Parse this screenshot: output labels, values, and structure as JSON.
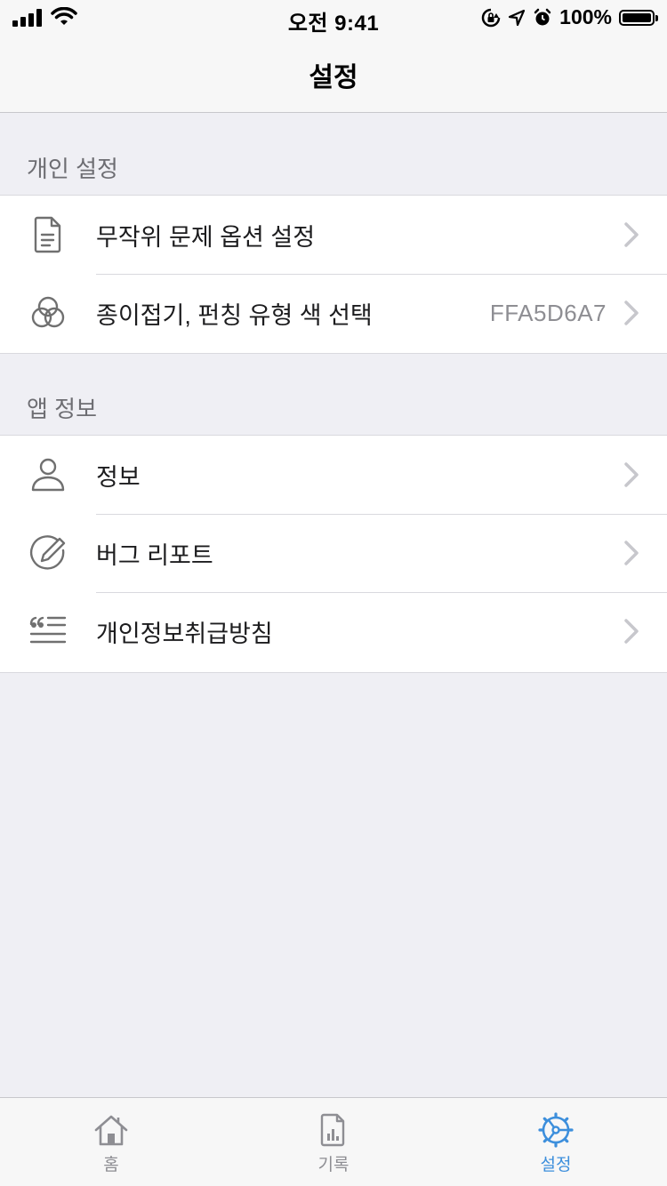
{
  "status_bar": {
    "time": "오전 9:41",
    "battery": "100%"
  },
  "nav": {
    "title": "설정"
  },
  "sections": [
    {
      "header": "개인 설정",
      "rows": [
        {
          "label": "무작위 문제 옵션 설정",
          "icon": "document-icon",
          "detail": ""
        },
        {
          "label": "종이접기, 펀칭 유형 색 선택",
          "icon": "color-circles-icon",
          "detail": "FFA5D6A7"
        }
      ]
    },
    {
      "header": "앱 정보",
      "rows": [
        {
          "label": "정보",
          "icon": "person-icon",
          "detail": ""
        },
        {
          "label": "버그 리포트",
          "icon": "edit-circle-icon",
          "detail": ""
        },
        {
          "label": "개인정보취급방침",
          "icon": "quote-lines-icon",
          "detail": ""
        }
      ]
    }
  ],
  "tab_bar": {
    "tabs": [
      {
        "label": "홈",
        "icon": "home-icon",
        "active": false
      },
      {
        "label": "기록",
        "icon": "chart-document-icon",
        "active": false
      },
      {
        "label": "설정",
        "icon": "gear-icon",
        "active": true
      }
    ]
  },
  "colors": {
    "background": "#efeff4",
    "accent": "#3d8fdc",
    "icon_gray": "#707070",
    "chevron": "#c7c7cc"
  }
}
